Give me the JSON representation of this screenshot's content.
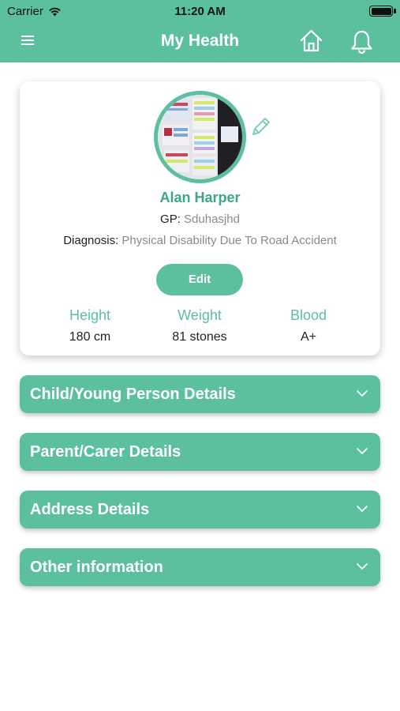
{
  "status_bar": {
    "carrier": "Carrier",
    "time": "11:20 AM"
  },
  "nav": {
    "title": "My Health"
  },
  "profile": {
    "name": "Alan Harper",
    "gp_label": "GP:",
    "gp_value": "Sduhasjhd",
    "diagnosis_label": "Diagnosis:",
    "diagnosis_value": "Physical Disability Due To Road Accident",
    "edit_label": "Edit",
    "stats": [
      {
        "label": "Height",
        "value": "180 cm"
      },
      {
        "label": "Weight",
        "value": "81 stones"
      },
      {
        "label": "Blood",
        "value": "A+"
      }
    ]
  },
  "sections": [
    {
      "label": "Child/Young Person Details"
    },
    {
      "label": "Parent/Carer Details"
    },
    {
      "label": "Address Details"
    },
    {
      "label": "Other information"
    }
  ],
  "colors": {
    "accent": "#5bbfa0",
    "accent_text": "#3fa685"
  },
  "icons": [
    "menu-icon",
    "home-icon",
    "bell-icon",
    "pencil-icon",
    "chevron-down-icon",
    "wifi-icon",
    "battery-icon"
  ]
}
